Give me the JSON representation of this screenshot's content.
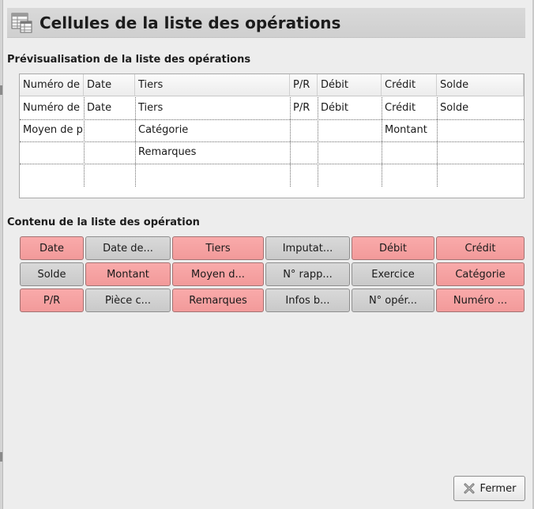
{
  "window": {
    "title": "Cellules de la liste des opérations",
    "icon": "table-settings-icon"
  },
  "preview": {
    "heading": "Prévisualisation de la liste des opérations",
    "columns": [
      "Numéro de",
      "Date",
      "Tiers",
      "P/R",
      "Débit",
      "Crédit",
      "Solde"
    ],
    "rows": [
      [
        "Numéro de",
        "Date",
        "Tiers",
        "P/R",
        "Débit",
        "Crédit",
        "Solde"
      ],
      [
        "Moyen de p",
        "",
        "Catégorie",
        "",
        "",
        "Montant",
        ""
      ],
      [
        "",
        "",
        "Remarques",
        "",
        "",
        "",
        ""
      ],
      [
        "",
        "",
        "",
        "",
        "",
        "",
        ""
      ]
    ]
  },
  "content": {
    "heading": "Contenu de la liste des opération",
    "buttons": [
      {
        "label": "Date",
        "active": true
      },
      {
        "label": "Date de...",
        "active": false
      },
      {
        "label": "Tiers",
        "active": true
      },
      {
        "label": "Imputat...",
        "active": false
      },
      {
        "label": "Débit",
        "active": true
      },
      {
        "label": "Crédit",
        "active": true
      },
      {
        "label": "Solde",
        "active": false
      },
      {
        "label": "Montant",
        "active": true
      },
      {
        "label": "Moyen d...",
        "active": true
      },
      {
        "label": "N° rapp...",
        "active": false
      },
      {
        "label": "Exercice",
        "active": false
      },
      {
        "label": "Catégorie",
        "active": true
      },
      {
        "label": "P/R",
        "active": true
      },
      {
        "label": "Pièce c...",
        "active": false
      },
      {
        "label": "Remarques",
        "active": true
      },
      {
        "label": "Infos b...",
        "active": false
      },
      {
        "label": "N° opér...",
        "active": false
      },
      {
        "label": "Numéro ...",
        "active": true
      }
    ]
  },
  "footer": {
    "close_label": "Fermer",
    "close_icon": "close-icon"
  },
  "colors": {
    "active": "#f29a9a",
    "inactive": "#cdcdcd",
    "background": "#ededed"
  }
}
